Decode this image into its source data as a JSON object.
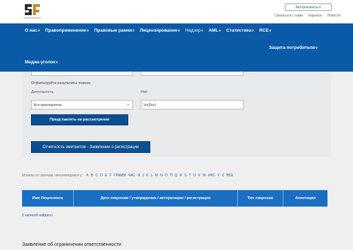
{
  "header": {
    "logo_caption": "FINSUPERVISION",
    "auth_button": "Авторизоваться",
    "links": [
      "Связаться с нами",
      "Карьера",
      "Новости"
    ]
  },
  "nav": {
    "row1": [
      {
        "label": "О нас",
        "caret": true
      },
      {
        "label": "Правоприменение",
        "caret": true
      },
      {
        "label": "Правовые рамки",
        "caret": true
      },
      {
        "label": "Лицензирование",
        "caret": true
      },
      {
        "label": "Надзор",
        "caret": true
      },
      {
        "label": "AML",
        "caret": true
      },
      {
        "label": "Статистика",
        "caret": true
      },
      {
        "label": "RCE",
        "caret": true
      }
    ],
    "consumer": "Защита потребителя",
    "media": "Медиа-уголок",
    "caret_glyph": "▾"
  },
  "search": {
    "filter_label": "Отфильтруйте результаты поиска",
    "activity_label": "Деятельность",
    "activity_value": "Все мероприятия",
    "name_label": "Имя",
    "name_value": "Vo(Des)",
    "submit_label": "Представлять на рассмотрение",
    "report_label": "Отчетность эмитентов - Заявление о регистрации"
  },
  "alphabet": {
    "intro": "Искать по именам, начинающимся с:",
    "letters": [
      "A",
      "B",
      "C",
      "D",
      "E",
      "F",
      "ГРАММ",
      "ЧАС",
      "Я",
      "J",
      "K",
      "L",
      "M",
      "N",
      "O",
      "П",
      "Q",
      "R",
      "S",
      "T",
      "U",
      "V",
      "W",
      "ИКС",
      "Y",
      "Z",
      "ВСЕ"
    ]
  },
  "table": {
    "columns": [
      "Имя Лицензиата",
      "Дата лицензии / утверждения / авторизации / регистрации",
      "Тип лицензии",
      "Аннотации"
    ],
    "empty_text": "0 записей найдено."
  },
  "footer": {
    "disclaimer_title": "Заявление об ограничении ответственности"
  },
  "colors": {
    "nav_bg": "#0b5aa8",
    "table_header_bg": "#1a6fc2",
    "button_bg": "#0b4f92"
  }
}
